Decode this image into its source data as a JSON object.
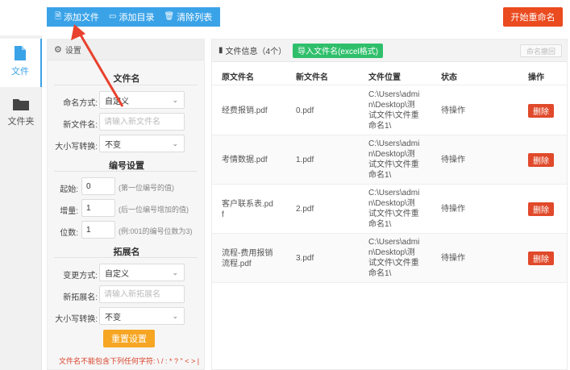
{
  "toolbar": {
    "add_file": "添加文件",
    "add_dir": "添加目录",
    "clear_list": "清除列表",
    "start_rename": "开始重命名"
  },
  "nav": {
    "file": "文件",
    "folder": "文件夹"
  },
  "settings": {
    "title": "设置",
    "filename_section": "文件名",
    "naming_mode_label": "命名方式:",
    "naming_mode_value": "自定义",
    "new_name_label": "新文件名:",
    "new_name_placeholder": "请输入新文件名",
    "case_label": "大小写转换:",
    "case_value": "不变",
    "numbering_section": "编号设置",
    "start_label": "起始:",
    "start_value": "0",
    "start_hint": "(第一位编号的值)",
    "step_label": "增量:",
    "step_value": "1",
    "step_hint": "(后一位编号增加的值)",
    "digits_label": "位数:",
    "digits_value": "1",
    "digits_hint": "(例:001的编号位数为3)",
    "ext_section": "拓展名",
    "ext_mode_label": "变更方式:",
    "ext_mode_value": "自定义",
    "new_ext_label": "新拓展名:",
    "new_ext_placeholder": "请输入新拓展名",
    "ext_case_label": "大小写转换:",
    "ext_case_value": "不变",
    "reset": "重置设置",
    "warning": "文件名不能包含下列任何字符: \\ / : * ? \" < > |"
  },
  "files": {
    "info": "文件信息（4个）",
    "import": "导入文件名(excel格式)",
    "rename_back": "命名撤回",
    "columns": [
      "原文件名",
      "新文件名",
      "文件位置",
      "状态",
      "操作"
    ],
    "rows": [
      {
        "orig": [
          "经费报销.pdf"
        ],
        "new": "0.pdf",
        "loc": [
          "C:\\Users\\admi",
          "n\\Desktop\\测",
          "试文件\\文件重",
          "命名1\\"
        ],
        "status": "待操作",
        "action": "删除"
      },
      {
        "orig": [
          "考情数据.pdf"
        ],
        "new": "1.pdf",
        "loc": [
          "C:\\Users\\admi",
          "n\\Desktop\\测",
          "试文件\\文件重",
          "命名1\\"
        ],
        "status": "待操作",
        "action": "删除"
      },
      {
        "orig": [
          "客户联系表.pd",
          "f"
        ],
        "new": "2.pdf",
        "loc": [
          "C:\\Users\\admi",
          "n\\Desktop\\测",
          "试文件\\文件重",
          "命名1\\"
        ],
        "status": "待操作",
        "action": "删除"
      },
      {
        "orig": [
          "流程-费用报销",
          "流程.pdf"
        ],
        "new": "3.pdf",
        "loc": [
          "C:\\Users\\admi",
          "n\\Desktop\\测",
          "试文件\\文件重",
          "命名1\\"
        ],
        "status": "待操作",
        "action": "删除"
      }
    ]
  },
  "colors": {
    "accent": "#3aa3e8",
    "start": "#ea4b1f",
    "import": "#2fbf6b",
    "reset": "#f6a623",
    "delete": "#e0492a",
    "annotation": "#e8412d"
  }
}
